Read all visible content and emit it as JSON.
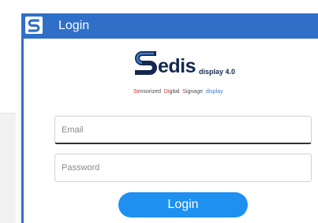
{
  "window": {
    "title": "Login",
    "app_icon": "sedis-s-logo-icon"
  },
  "logo": {
    "brand": "edis",
    "sub": "display 4.0",
    "tagline": {
      "p1a": "Se",
      "p1b": "nsorized",
      "p2a": "Di",
      "p2b": "gital",
      "p3a": "S",
      "p3b": "ignage",
      "p4": "display"
    }
  },
  "form": {
    "email_placeholder": "Email",
    "password_placeholder": "Password",
    "login_label": "Login"
  },
  "colors": {
    "titlebar": "#2f6fc8",
    "button": "#1e90f0",
    "brand_dark": "#14284f",
    "tagline_red": "#cc2a2a",
    "tagline_blue": "#3f7fd6"
  }
}
